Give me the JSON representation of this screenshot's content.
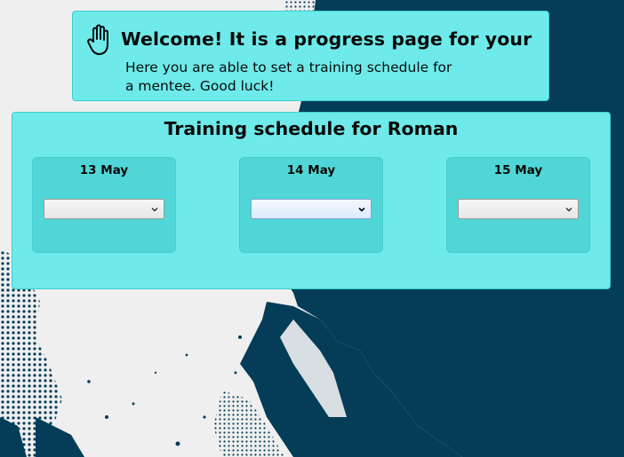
{
  "welcome": {
    "title": "Welcome! It is a progress page for your",
    "text": "Here you are able to set a training schedule for a mentee. Good luck!"
  },
  "schedule": {
    "title": "Training schedule for Roman",
    "days": [
      {
        "label": "13 May",
        "selected": ""
      },
      {
        "label": "14 May",
        "selected": ""
      },
      {
        "label": "15 May",
        "selected": ""
      }
    ]
  },
  "icons": {
    "welcome": "hand-icon",
    "select": "chevron-down-icon"
  },
  "colors": {
    "card": "#6eeaea",
    "day_card": "#50d6d6",
    "background_dark": "#053d59",
    "background_light": "#efefef"
  }
}
